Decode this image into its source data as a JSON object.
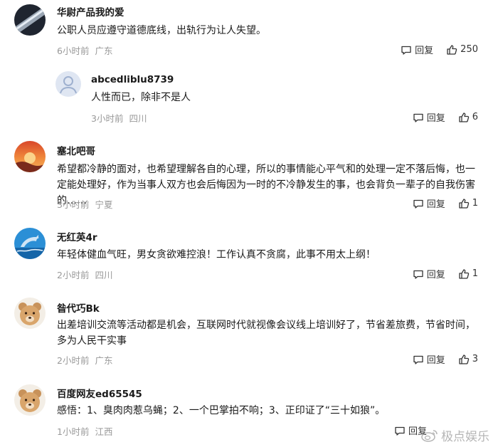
{
  "comments": [
    {
      "user": "华尉产品我的爱",
      "text": "公职人员应遵守道德底线，出轨行为让人失望。",
      "time": "6小时前",
      "location": "广东",
      "reply_label": "回复",
      "likes": "250",
      "avatar": "metal-avatar"
    },
    {
      "user": "abcedliblu8739",
      "text": "人性而已，除非不是人",
      "time": "3小时前",
      "location": "四川",
      "reply_label": "回复",
      "likes": "6",
      "avatar": "default-user-avatar"
    },
    {
      "user": "塞北吧哥",
      "text": "希望都冷静的面对，也希望理解各自的心理，所以的事情能心平气和的处理一定不落后悔，也一定能处理好，作为当事人双方也会后悔因为一时的不冷静发生的事，也会背负一辈子的自我伤害的……",
      "time": "3小时前",
      "location": "宁夏",
      "reply_label": "回复",
      "likes": "1",
      "avatar": "sunset-avatar"
    },
    {
      "user": "无红英4r",
      "text": "年轻体健血气旺，男女贪欲难控浪！工作认真不贪腐，此事不用太上纲！",
      "time": "2小时前",
      "location": "四川",
      "reply_label": "回复",
      "likes": "1",
      "avatar": "dolphin-avatar"
    },
    {
      "user": "昝代巧Bk",
      "text": "出差培训交流等活动都是机会，互联网时代就视像会议线上培训好了，节省差旅费，节省时间，多为人民干实事",
      "time": "2小时前",
      "location": "广东",
      "reply_label": "回复",
      "likes": "3",
      "avatar": "bear-avatar"
    },
    {
      "user": "百度网友ed65545",
      "text": "感悟：1、臭肉肉惹乌蝇；2、一个巴掌拍不响；3、正印证了“三十如狼”。",
      "time": "1小时前",
      "location": "江西",
      "reply_label": "回复",
      "likes": "",
      "avatar": "bear-avatar"
    }
  ],
  "watermark": "极点娱乐",
  "colors": {
    "text": "#1a1a1a",
    "meta": "#999999",
    "watermark": "#8c8c8c"
  }
}
